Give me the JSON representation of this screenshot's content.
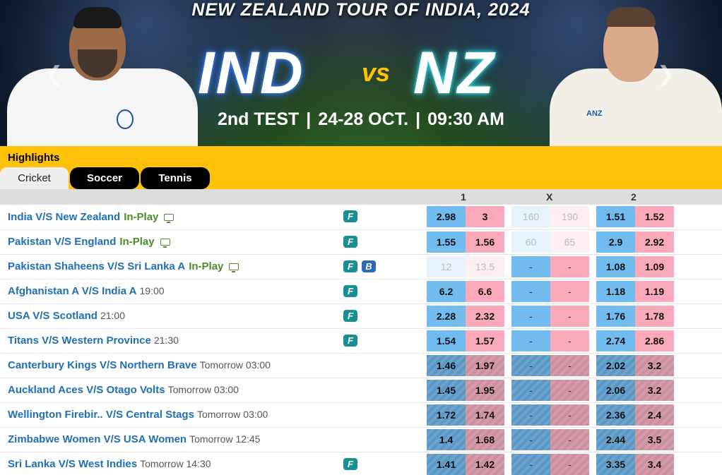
{
  "banner": {
    "title": "NEW ZEALAND TOUR OF INDIA, 2024",
    "team1": "IND",
    "vs": "vs",
    "team2": "NZ",
    "test": "2nd TEST",
    "dates": "24-28 OCT.",
    "time": "09:30 AM",
    "sep": "|"
  },
  "highlights": {
    "title": "Highlights",
    "tabs": [
      "Cricket",
      "Soccer",
      "Tennis"
    ]
  },
  "columns": {
    "c1": "1",
    "cx": "X",
    "c2": "2"
  },
  "matches": [
    {
      "name": "India V/S New Zealand",
      "status": "In-Play",
      "time": "",
      "badges": [
        "F"
      ],
      "odds": [
        [
          "2.98",
          "3"
        ],
        [
          "160",
          "190"
        ],
        [
          "1.51",
          "1.52"
        ]
      ],
      "style": [
        "normal",
        "faded",
        "normal"
      ]
    },
    {
      "name": "Pakistan V/S England",
      "status": "In-Play",
      "time": "",
      "badges": [
        "F"
      ],
      "odds": [
        [
          "1.55",
          "1.56"
        ],
        [
          "60",
          "65"
        ],
        [
          "2.9",
          "2.92"
        ]
      ],
      "style": [
        "normal",
        "faded",
        "normal"
      ]
    },
    {
      "name": "Pakistan Shaheens V/S Sri Lanka A",
      "status": "In-Play",
      "time": "",
      "badges": [
        "F",
        "B"
      ],
      "odds": [
        [
          "12",
          "13.5"
        ],
        [
          "-",
          "-"
        ],
        [
          "1.08",
          "1.09"
        ]
      ],
      "style": [
        "faded",
        "normal",
        "normal"
      ]
    },
    {
      "name": "Afghanistan A V/S India A",
      "status": "",
      "time": "19:00",
      "badges": [
        "F"
      ],
      "odds": [
        [
          "6.2",
          "6.6"
        ],
        [
          "-",
          "-"
        ],
        [
          "1.18",
          "1.19"
        ]
      ],
      "style": [
        "normal",
        "normal",
        "normal"
      ]
    },
    {
      "name": "USA V/S Scotland",
      "status": "",
      "time": "21:00",
      "badges": [
        "F"
      ],
      "odds": [
        [
          "2.28",
          "2.32"
        ],
        [
          "-",
          "-"
        ],
        [
          "1.76",
          "1.78"
        ]
      ],
      "style": [
        "normal",
        "normal",
        "normal"
      ]
    },
    {
      "name": "Titans V/S Western Province",
      "status": "",
      "time": "21:30",
      "badges": [
        "F"
      ],
      "odds": [
        [
          "1.54",
          "1.57"
        ],
        [
          "-",
          "-"
        ],
        [
          "2.74",
          "2.86"
        ]
      ],
      "style": [
        "normal",
        "normal",
        "normal"
      ]
    },
    {
      "name": "Canterbury Kings V/S Northern Brave",
      "status": "",
      "time": "Tomorrow  03:00",
      "badges": [],
      "odds": [
        [
          "1.46",
          "1.97"
        ],
        [
          "-",
          "-"
        ],
        [
          "2.02",
          "3.2"
        ]
      ],
      "style": [
        "susp",
        "susp",
        "susp"
      ]
    },
    {
      "name": "Auckland Aces V/S Otago Volts",
      "status": "",
      "time": "Tomorrow  03:00",
      "badges": [],
      "odds": [
        [
          "1.45",
          "1.95"
        ],
        [
          "-",
          "-"
        ],
        [
          "2.06",
          "3.2"
        ]
      ],
      "style": [
        "susp",
        "susp",
        "susp"
      ]
    },
    {
      "name": "Wellington Firebir.. V/S Central Stags",
      "status": "",
      "time": "Tomorrow  03:00",
      "badges": [],
      "odds": [
        [
          "1.72",
          "1.74"
        ],
        [
          "-",
          "-"
        ],
        [
          "2.36",
          "2.4"
        ]
      ],
      "style": [
        "susp",
        "susp",
        "susp"
      ]
    },
    {
      "name": "Zimbabwe Women V/S USA Women",
      "status": "",
      "time": "Tomorrow  12:45",
      "badges": [],
      "odds": [
        [
          "1.4",
          "1.68"
        ],
        [
          "-",
          "-"
        ],
        [
          "2.44",
          "3.5"
        ]
      ],
      "style": [
        "susp",
        "susp",
        "susp"
      ]
    },
    {
      "name": "Sri Lanka V/S West Indies",
      "status": "",
      "time": "Tomorrow  14:30",
      "badges": [
        "F"
      ],
      "odds": [
        [
          "1.41",
          "1.42"
        ],
        [
          "-",
          "-"
        ],
        [
          "3.35",
          "3.4"
        ]
      ],
      "style": [
        "susp",
        "susp",
        "susp"
      ]
    }
  ]
}
